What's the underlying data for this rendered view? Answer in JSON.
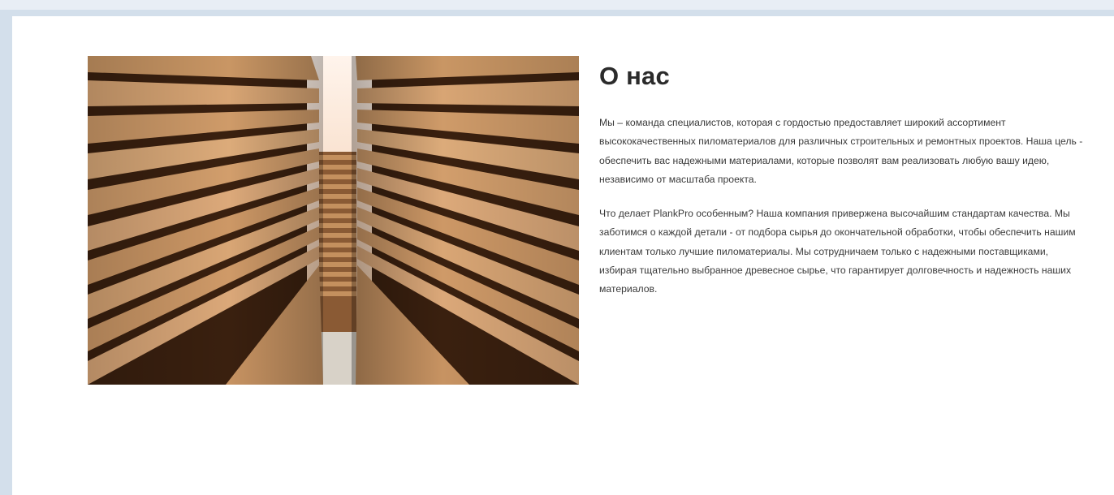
{
  "about": {
    "title": "О нас",
    "paragraph1": "Мы – команда специалистов, которая с гордостью предоставляет широкий ассортимент высококачественных пиломатериалов для различных строительных и ремонтных проектов. Наша цель - обеспечить вас надежными материалами, которые позволят вам реализовать любую вашу идею, независимо от масштаба проекта.",
    "paragraph2": "Что делает PlankPro особенным? Наша компания привержена высочайшим стандартам качества. Мы заботимся о каждой детали - от подбора сырья до окончательной обработки, чтобы обеспечить нашим клиентам только лучшие пиломатериалы. Мы сотрудничаем только с надежными поставщиками, избирая тщательно выбранное древесное сырье, что гарантирует долговечность и надежность наших материалов.",
    "image": "stacked-lumber-photo"
  },
  "colors": {
    "page_background": "#ffffff",
    "frame": "#d3dfeb",
    "text": "#3a3a3a",
    "heading": "#2b2b2b",
    "wood_light": "#d9a877",
    "wood_dark": "#3a200f"
  }
}
